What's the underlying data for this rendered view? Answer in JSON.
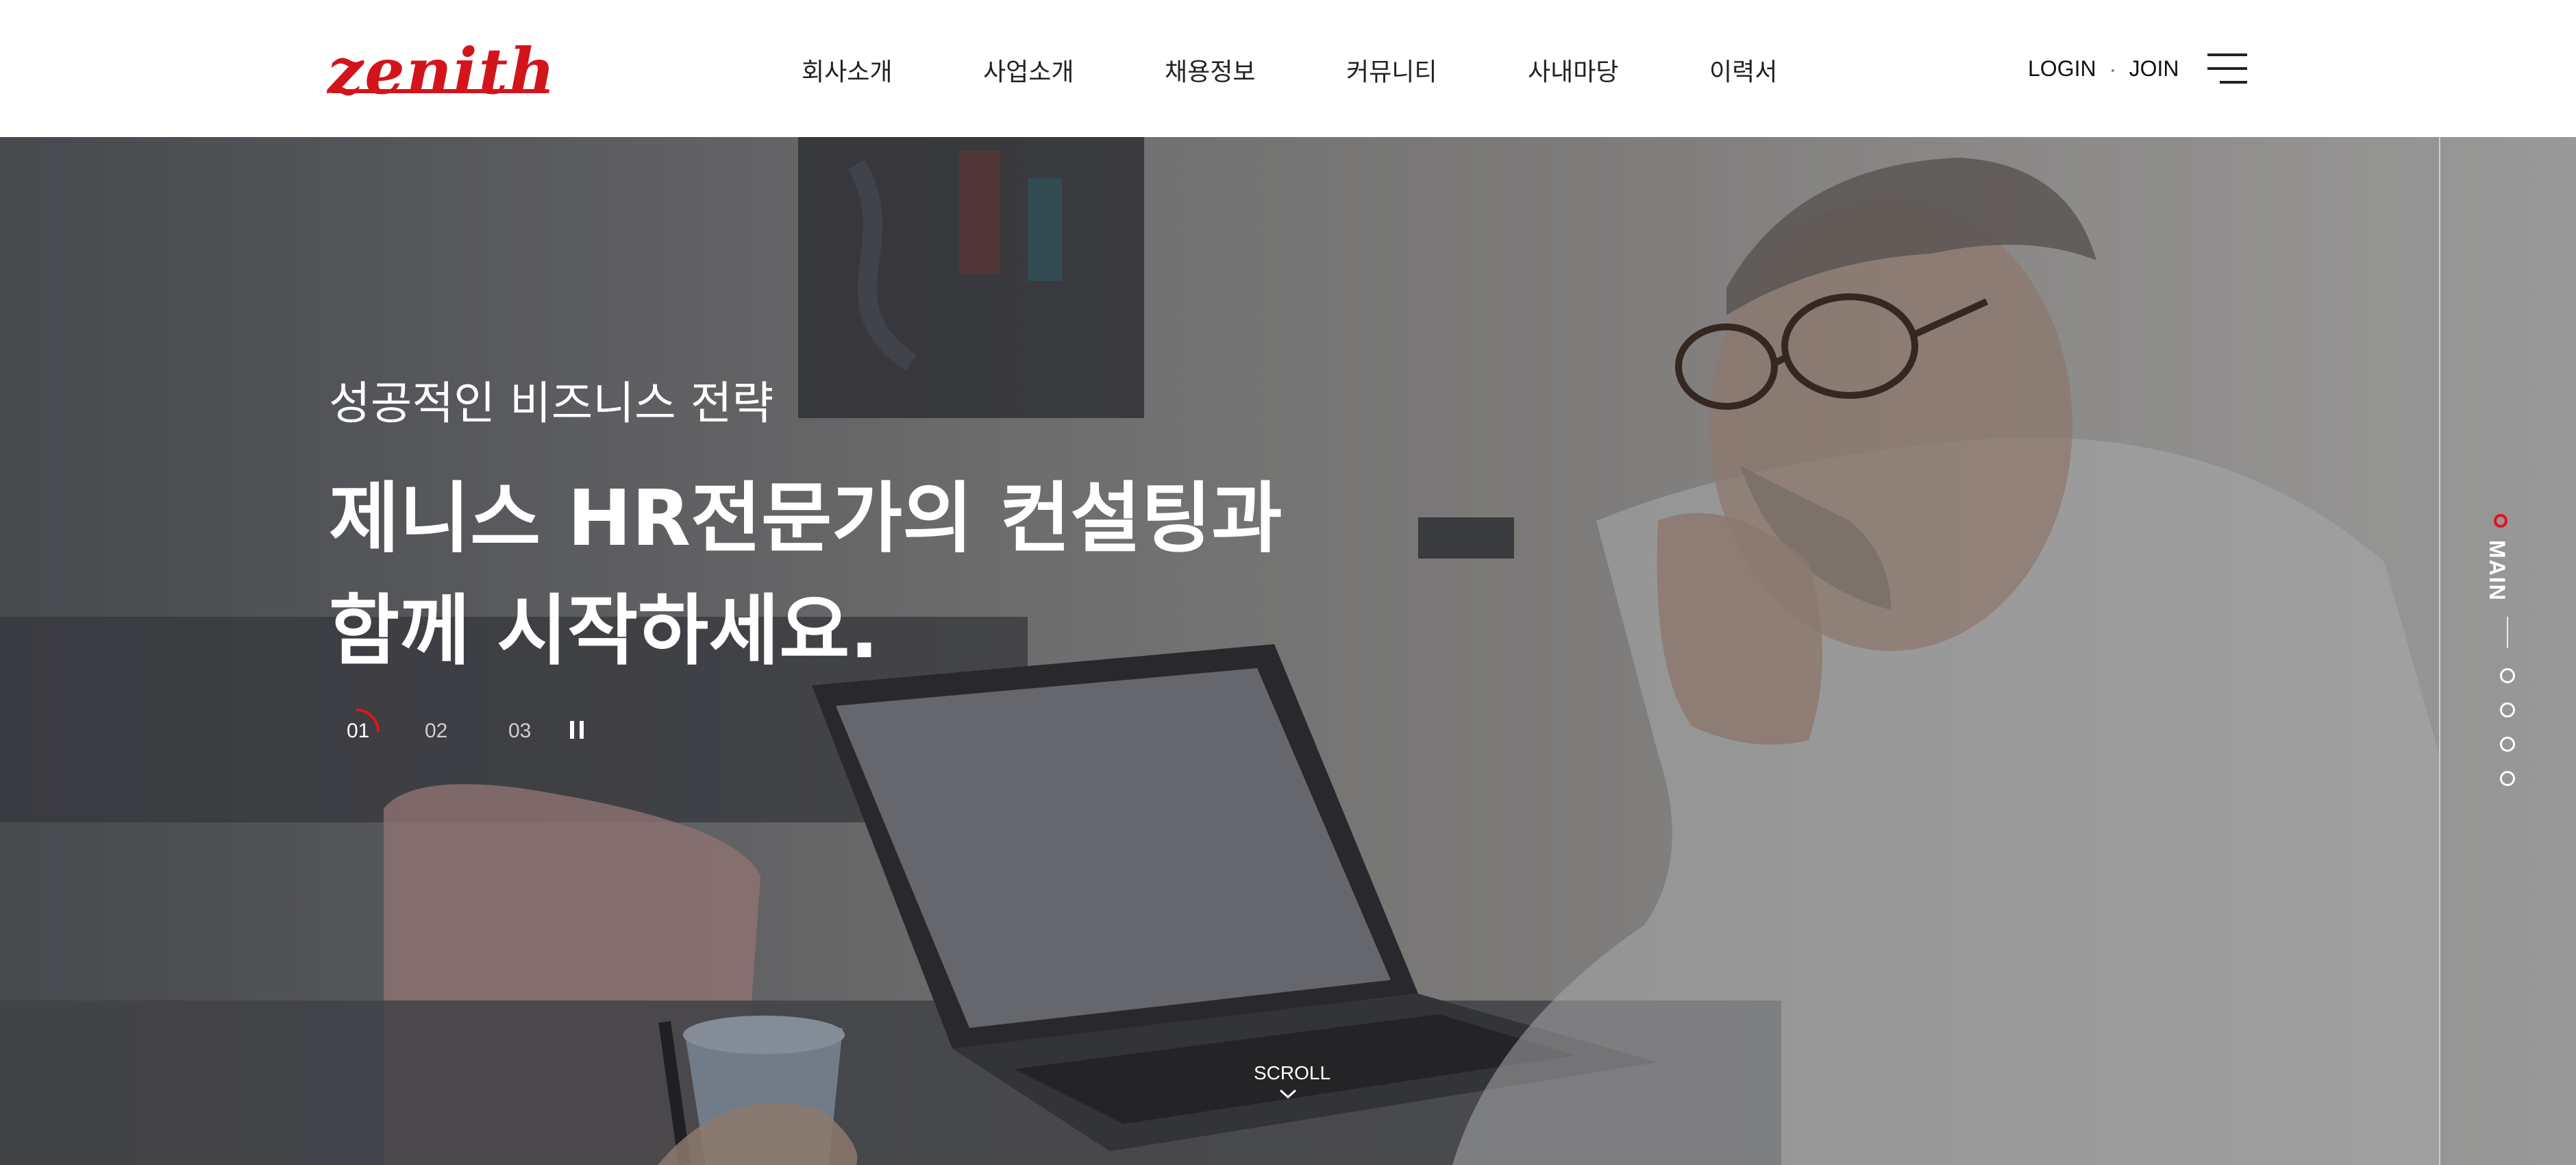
{
  "brand": {
    "logo_text": "zenith",
    "logo_color": "#d3141b"
  },
  "nav": {
    "items": [
      {
        "label": "회사소개"
      },
      {
        "label": "사업소개"
      },
      {
        "label": "채용정보"
      },
      {
        "label": "커뮤니티"
      },
      {
        "label": "사내마당"
      },
      {
        "label": "이력서"
      }
    ]
  },
  "util": {
    "login": "LOGIN",
    "join": "JOIN",
    "menu_icon": "hamburger-icon"
  },
  "hero": {
    "subtitle": "성공적인 비즈니스 전략",
    "title_line1": "제니스 HR전문가의 컨설팅과",
    "title_line2": "함께 시작하세요.",
    "slides": [
      "01",
      "02",
      "03"
    ],
    "active_slide": "01",
    "pause_icon": "pause-icon",
    "scroll_label": "SCROLL",
    "accent_color": "#e1141b"
  },
  "side_nav": {
    "active_label": "MAIN",
    "section_count_icons": [
      "circle-icon",
      "circle-icon",
      "circle-icon",
      "circle-icon"
    ]
  }
}
